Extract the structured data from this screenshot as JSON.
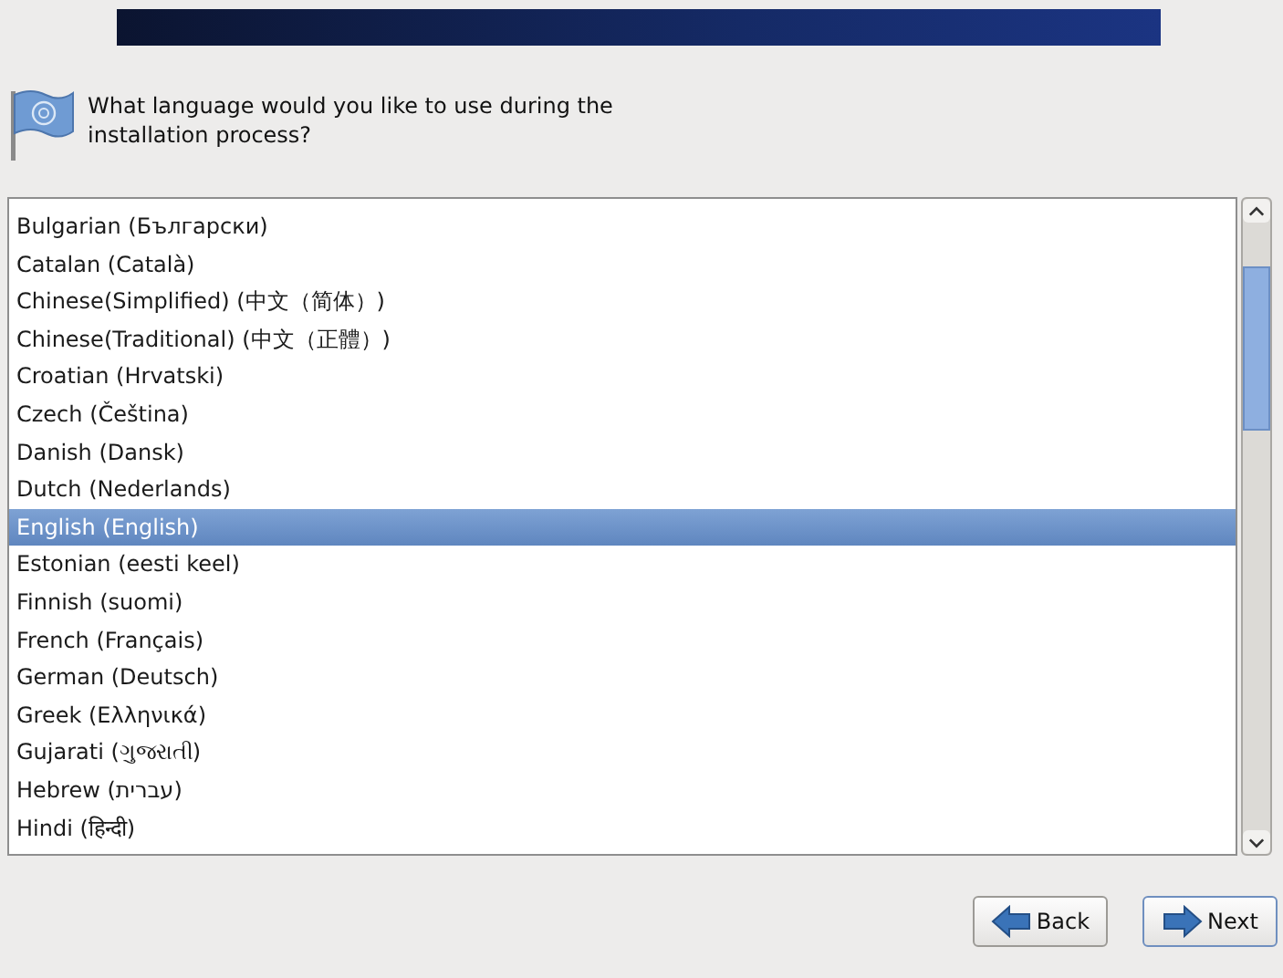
{
  "prompt": "What language would you like to use during the installation process?",
  "languages": [
    {
      "label": "Bulgarian (Български)",
      "selected": false
    },
    {
      "label": "Catalan (Català)",
      "selected": false
    },
    {
      "label": "Chinese(Simplified) (中文（简体）)",
      "selected": false
    },
    {
      "label": "Chinese(Traditional) (中文（正體）)",
      "selected": false
    },
    {
      "label": "Croatian (Hrvatski)",
      "selected": false
    },
    {
      "label": "Czech (Čeština)",
      "selected": false
    },
    {
      "label": "Danish (Dansk)",
      "selected": false
    },
    {
      "label": "Dutch (Nederlands)",
      "selected": false
    },
    {
      "label": "English (English)",
      "selected": true
    },
    {
      "label": "Estonian (eesti keel)",
      "selected": false
    },
    {
      "label": "Finnish (suomi)",
      "selected": false
    },
    {
      "label": "French (Français)",
      "selected": false
    },
    {
      "label": "German (Deutsch)",
      "selected": false
    },
    {
      "label": "Greek (Ελληνικά)",
      "selected": false
    },
    {
      "label": "Gujarati (ગુજરાતી)",
      "selected": false
    },
    {
      "label": "Hebrew (עברית)",
      "selected": false
    },
    {
      "label": "Hindi (हिन्दी)",
      "selected": false
    }
  ],
  "buttons": [
    {
      "label": "Back",
      "kind": "back"
    },
    {
      "label": "Next",
      "kind": "next"
    }
  ]
}
